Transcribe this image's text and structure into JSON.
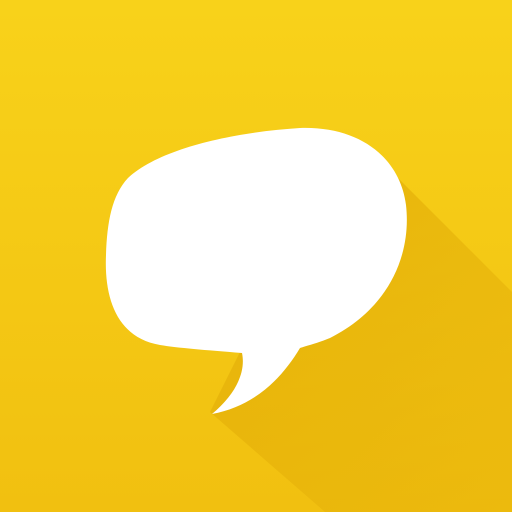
{
  "icon": {
    "name": "chat-bubble-icon",
    "colors": {
      "background_top": "#F8D21A",
      "background_bottom": "#F1C010",
      "long_shadow": "#E3AE08",
      "bubble": "#FFFFFF"
    }
  }
}
